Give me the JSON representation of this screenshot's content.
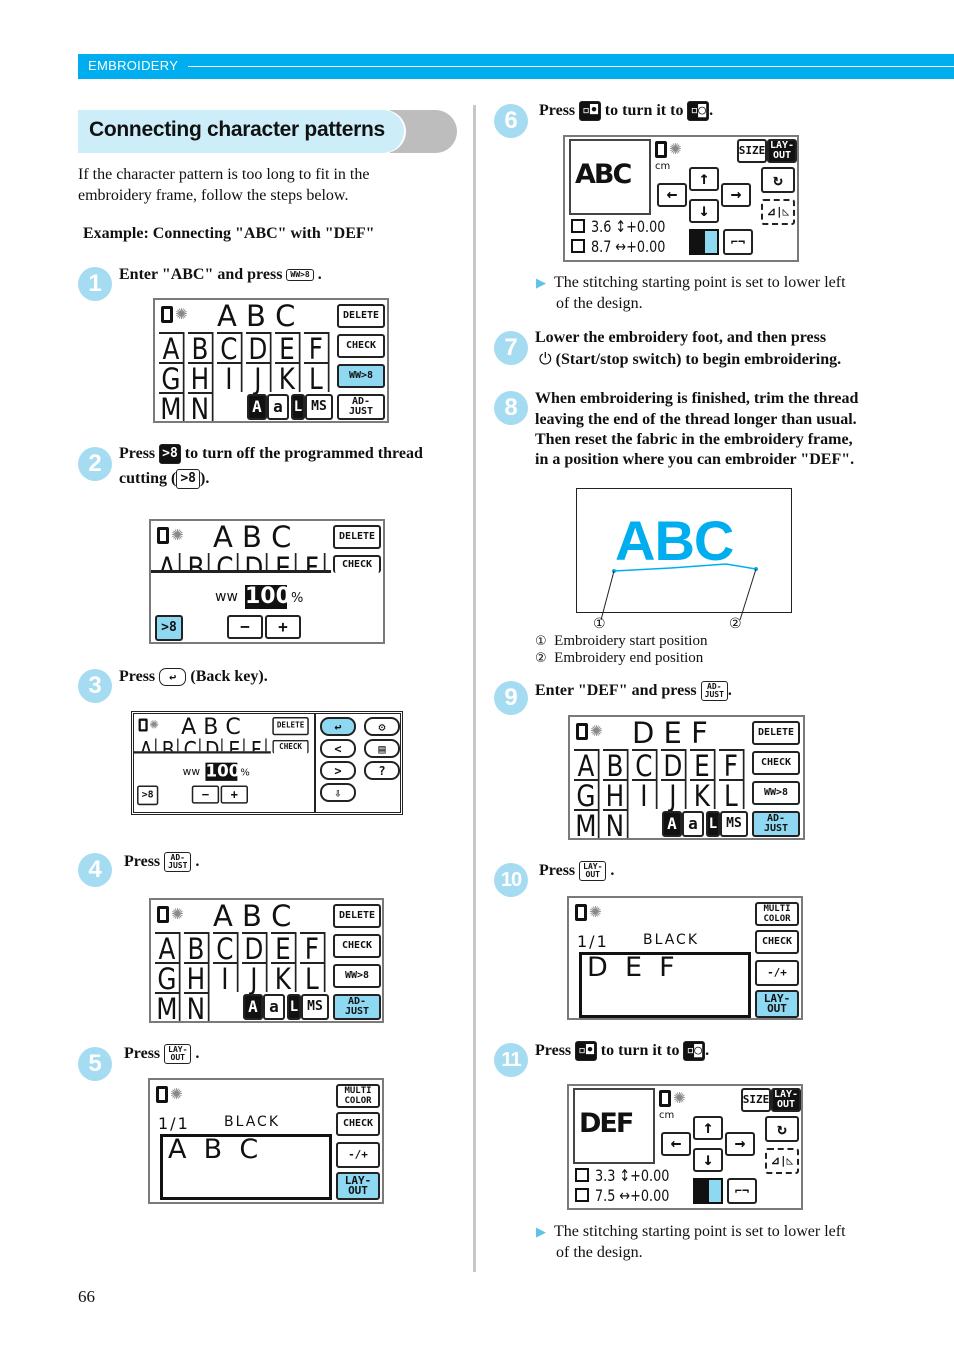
{
  "header": {
    "section": "EMBROIDERY",
    "accent": "#00aeef"
  },
  "title": "Connecting character patterns",
  "intro": [
    "If the character pattern is too long to fit in the",
    "embroidery frame, follow the steps below."
  ],
  "example": "Example: Connecting \"ABC\" with \"DEF\"",
  "page_number": "66",
  "keys": {
    "thread_cut": "WW>8",
    "adjust": "AD-\nJUST",
    "layout": "LAY-\nOUT",
    "back": "↩",
    "start_left": "▫◘",
    "start_lower": "▫◙",
    "start_stop": "⏻"
  },
  "steps": [
    {
      "n": "1",
      "text": [
        "Enter \"ABC\" and press",
        "."
      ],
      "screen": {
        "type": "entry",
        "pattern": "A B C",
        "letters": [
          "A",
          "B",
          "C",
          "D",
          "E",
          "F",
          "G",
          "H",
          "I",
          "J",
          "K",
          "L",
          "M",
          "N"
        ],
        "delete": "DELETE",
        "check": "CHECK",
        "thread": "WW>8",
        "case": [
          "A",
          "a"
        ],
        "sizes": [
          "L",
          "MS"
        ],
        "adjust": "AD-\nJUST",
        "highlight": "thread"
      }
    },
    {
      "n": "2",
      "text": [
        "Press",
        "to turn off the programmed thread",
        "cutting (",
        ")."
      ],
      "screen": {
        "type": "cut",
        "pattern": "A B C",
        "letters": [
          "A",
          "B",
          "C",
          "D",
          "E",
          "F"
        ],
        "delete": "DELETE",
        "check": "CHECK",
        "percent": "100",
        "percent_unit": "%",
        "minus": "−",
        "plus": "+",
        "scissor": ">8"
      }
    },
    {
      "n": "3",
      "text": [
        "Press",
        "(Back key)."
      ],
      "screen": {
        "type": "cut-panel",
        "pattern": "A B C",
        "letters": [
          "A",
          "B",
          "C",
          "D",
          "E",
          "F"
        ],
        "delete": "DELETE",
        "check": "CHECK",
        "percent": "100",
        "percent_unit": "%",
        "minus": "−",
        "plus": "+",
        "scissor": ">8",
        "panel": [
          "↩",
          "<",
          ">",
          "⇩",
          "⚙",
          "▤",
          "?"
        ]
      }
    },
    {
      "n": "4",
      "text": [
        "Press",
        "."
      ],
      "screen": {
        "type": "entry",
        "pattern": "A B C",
        "letters": [
          "A",
          "B",
          "C",
          "D",
          "E",
          "F",
          "G",
          "H",
          "I",
          "J",
          "K",
          "L",
          "M",
          "N"
        ],
        "delete": "DELETE",
        "check": "CHECK",
        "thread": "WW>8",
        "case": [
          "A",
          "a"
        ],
        "sizes": [
          "L",
          "MS"
        ],
        "adjust": "AD-\nJUST",
        "highlight": "adjust"
      }
    },
    {
      "n": "5",
      "text": [
        "Press",
        "."
      ],
      "screen": {
        "type": "color",
        "count": "1/1",
        "color": "BLACK",
        "pattern": "A  B  C",
        "multi": "MULTI\nCOLOR",
        "check": "CHECK",
        "thread": "-/+",
        "layout": "LAY-\nOUT"
      }
    },
    {
      "n": "6",
      "text": [
        "Press",
        "to turn it to",
        "."
      ],
      "result": [
        "The stitching starting point is set to lower left",
        "of the design."
      ],
      "screen": {
        "type": "layout",
        "preview": "ABC",
        "unit": "cm",
        "size": "SIZE",
        "layout": "LAY-\nOUT",
        "height": "3.6",
        "width": "8.7",
        "offset_v": "+0.00",
        "offset_h": "+0.00"
      }
    },
    {
      "n": "7",
      "text": [
        "Lower the embroidery foot, and then press",
        "(Start/stop switch) to begin embroidering."
      ]
    },
    {
      "n": "8",
      "text": [
        "When embroidering is finished, trim the thread",
        "leaving the end of the thread longer than usual.",
        "Then reset the fabric in the embroidery frame,",
        "in a position where you can embroider \"DEF\"."
      ],
      "figure": {
        "text": "ABC",
        "color": "#00aeef",
        "callouts": [
          "①",
          "②"
        ],
        "legend": [
          {
            "mark": "①",
            "label": "Embroidery start position"
          },
          {
            "mark": "②",
            "label": "Embroidery end position"
          }
        ]
      }
    },
    {
      "n": "9",
      "text": [
        "Enter \"DEF\" and press",
        "."
      ],
      "screen": {
        "type": "entry",
        "pattern": "D E F",
        "letters": [
          "A",
          "B",
          "C",
          "D",
          "E",
          "F",
          "G",
          "H",
          "I",
          "J",
          "K",
          "L",
          "M",
          "N"
        ],
        "delete": "DELETE",
        "check": "CHECK",
        "thread": "WW>8",
        "case": [
          "A",
          "a"
        ],
        "sizes": [
          "L",
          "MS"
        ],
        "adjust": "AD-\nJUST",
        "highlight": "adjust"
      }
    },
    {
      "n": "10",
      "text": [
        "Press",
        "."
      ],
      "screen": {
        "type": "color",
        "count": "1/1",
        "color": "BLACK",
        "pattern": "D  E  F",
        "multi": "MULTI\nCOLOR",
        "check": "CHECK",
        "thread": "-/+",
        "layout": "LAY-\nOUT"
      }
    },
    {
      "n": "11",
      "text": [
        "Press",
        "to turn it to",
        "."
      ],
      "result": [
        "The stitching starting point is set to lower left",
        "of the design."
      ],
      "screen": {
        "type": "layout",
        "preview": "DEF",
        "unit": "cm",
        "size": "SIZE",
        "layout": "LAY-\nOUT",
        "height": "3.3",
        "width": "7.5",
        "offset_v": "+0.00",
        "offset_h": "+0.00"
      }
    }
  ]
}
